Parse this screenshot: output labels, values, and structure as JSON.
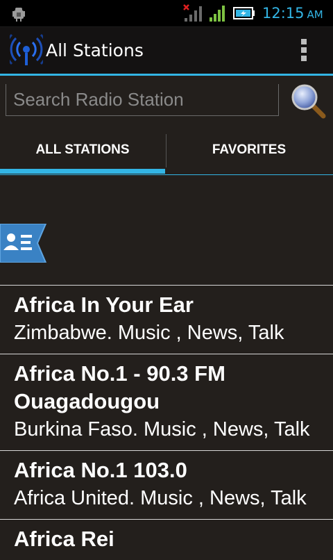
{
  "status_bar": {
    "time": "12:15",
    "ampm": "AM",
    "icons": [
      "android-debug-icon",
      "signal-no-service-icon",
      "wifi-signal-icon",
      "battery-charging-icon"
    ],
    "accent_color": "#33b5e5"
  },
  "action_bar": {
    "title": "All Stations",
    "app_icon": "radio-waves-icon",
    "overflow_icon": "overflow-menu-icon"
  },
  "search": {
    "placeholder": "Search Radio Station",
    "value": "",
    "icon": "magnifier-icon"
  },
  "tabs": [
    {
      "label": "ALL STATIONS",
      "selected": true
    },
    {
      "label": "FAVORITES",
      "selected": false
    }
  ],
  "floating_tag": {
    "icon": "contact-list-icon"
  },
  "stations": [
    {
      "name": "Africa In Your Ear",
      "desc": "Zimbabwe. Music , News, Talk"
    },
    {
      "name": "Africa No.1 - 90.3 FM Ouagadougou",
      "desc": "Burkina Faso. Music , News, Talk"
    },
    {
      "name": "Africa No.1 103.0",
      "desc": "Africa United. Music , News, Talk"
    },
    {
      "name": "Africa Rei",
      "desc": ""
    }
  ]
}
